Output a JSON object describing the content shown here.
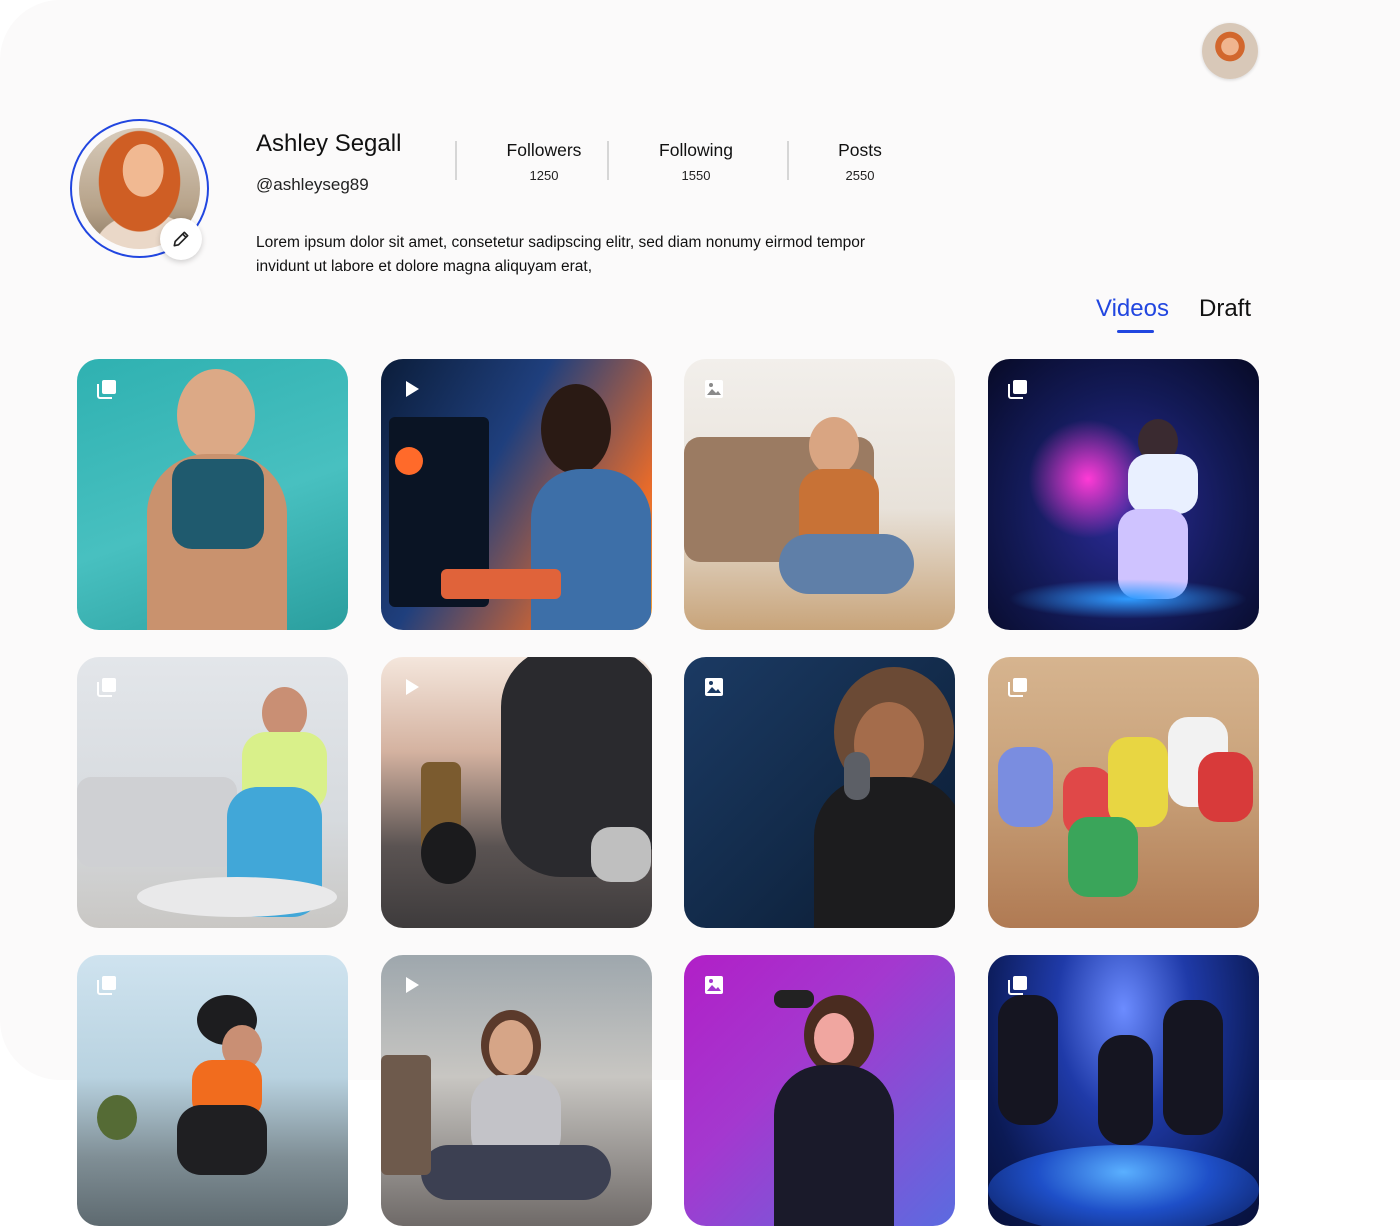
{
  "profile": {
    "name": "Ashley Segall",
    "handle": "@ashleyseg89",
    "bio": "Lorem ipsum dolor sit amet, consetetur sadipscing elitr, sed diam nonumy eirmod tempor invidunt ut labore et dolore magna aliquyam erat,"
  },
  "stats": {
    "followers_label": "Followers",
    "followers_value": "1250",
    "following_label": "Following",
    "following_value": "1550",
    "posts_label": "Posts",
    "posts_value": "2550"
  },
  "tabs": {
    "videos": "Videos",
    "draft": "Draft",
    "active": "Videos"
  },
  "colors": {
    "accent": "#2146e0",
    "panel_bg": "#fbfafa"
  },
  "icons": {
    "edit": "pencil-icon",
    "gallery": "gallery-icon",
    "video": "play-icon",
    "image": "image-icon"
  },
  "posts": [
    {
      "type": "gallery"
    },
    {
      "type": "video"
    },
    {
      "type": "image"
    },
    {
      "type": "gallery"
    },
    {
      "type": "gallery"
    },
    {
      "type": "video"
    },
    {
      "type": "image"
    },
    {
      "type": "gallery"
    },
    {
      "type": "gallery"
    },
    {
      "type": "video"
    },
    {
      "type": "image"
    },
    {
      "type": "gallery"
    }
  ]
}
